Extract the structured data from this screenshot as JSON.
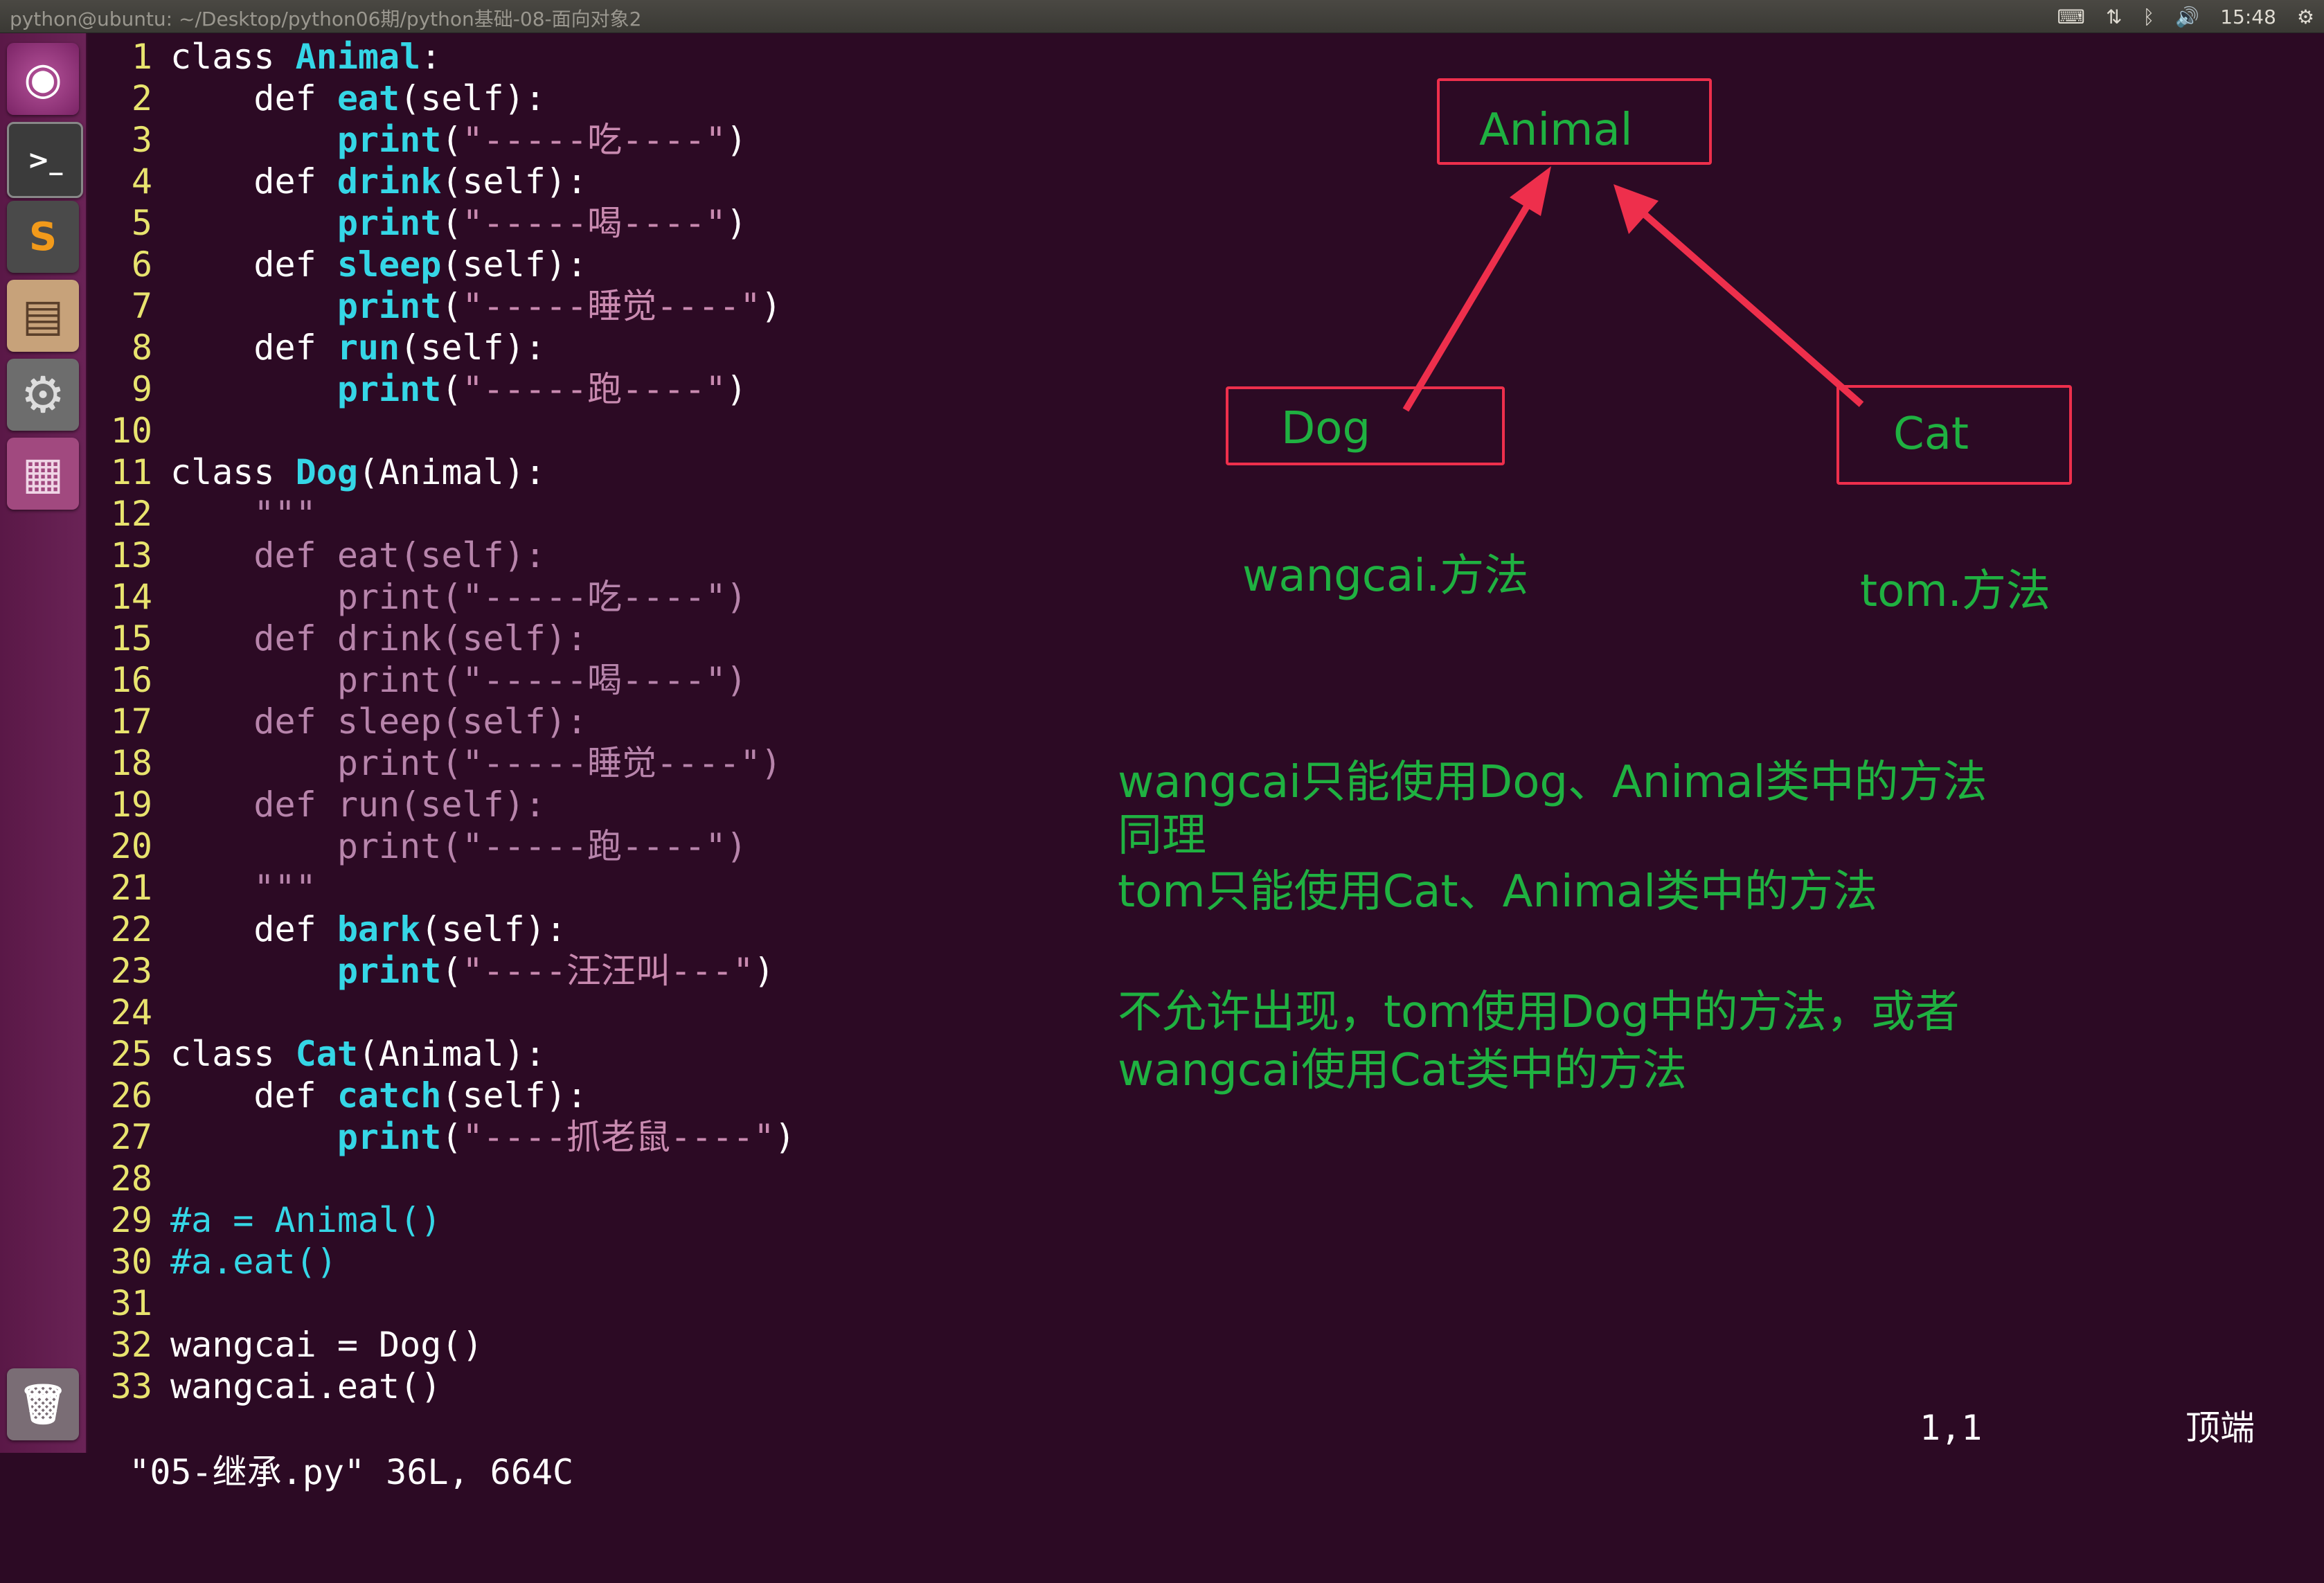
{
  "window": {
    "title": "python@ubuntu: ~/Desktop/python06期/python基础-08-面向对象2",
    "clock": "15:48"
  },
  "launcher": {
    "items": [
      {
        "name": "dash-icon",
        "glyph": "◉"
      },
      {
        "name": "terminal-icon",
        "glyph": ">_"
      },
      {
        "name": "sublime-text-icon",
        "glyph": "S"
      },
      {
        "name": "file-cabinet-icon",
        "glyph": "▤"
      },
      {
        "name": "settings-icon",
        "glyph": "⚙"
      },
      {
        "name": "workspace-switcher-icon",
        "glyph": "▦"
      },
      {
        "name": "trash-icon",
        "glyph": "🗑"
      }
    ]
  },
  "code": {
    "lines": [
      {
        "n": "1",
        "code": "class Animal:"
      },
      {
        "n": "2",
        "code": "    def eat(self):"
      },
      {
        "n": "3",
        "code": "        print(\"-----吃----\")"
      },
      {
        "n": "4",
        "code": "    def drink(self):"
      },
      {
        "n": "5",
        "code": "        print(\"-----喝----\")"
      },
      {
        "n": "6",
        "code": "    def sleep(self):"
      },
      {
        "n": "7",
        "code": "        print(\"-----睡觉----\")"
      },
      {
        "n": "8",
        "code": "    def run(self):"
      },
      {
        "n": "9",
        "code": "        print(\"-----跑----\")"
      },
      {
        "n": "10",
        "code": ""
      },
      {
        "n": "11",
        "code": "class Dog(Animal):"
      },
      {
        "n": "12",
        "code": "    \"\"\""
      },
      {
        "n": "13",
        "code": "    def eat(self):"
      },
      {
        "n": "14",
        "code": "        print(\"-----吃----\")"
      },
      {
        "n": "15",
        "code": "    def drink(self):"
      },
      {
        "n": "16",
        "code": "        print(\"-----喝----\")"
      },
      {
        "n": "17",
        "code": "    def sleep(self):"
      },
      {
        "n": "18",
        "code": "        print(\"-----睡觉----\")"
      },
      {
        "n": "19",
        "code": "    def run(self):"
      },
      {
        "n": "20",
        "code": "        print(\"-----跑----\")"
      },
      {
        "n": "21",
        "code": "    \"\"\""
      },
      {
        "n": "22",
        "code": "    def bark(self):"
      },
      {
        "n": "23",
        "code": "        print(\"----汪汪叫---\")"
      },
      {
        "n": "24",
        "code": ""
      },
      {
        "n": "25",
        "code": "class Cat(Animal):"
      },
      {
        "n": "26",
        "code": "    def catch(self):"
      },
      {
        "n": "27",
        "code": "        print(\"----抓老鼠----\")"
      },
      {
        "n": "28",
        "code": ""
      },
      {
        "n": "29",
        "code": "#a = Animal()"
      },
      {
        "n": "30",
        "code": "#a.eat()"
      },
      {
        "n": "31",
        "code": ""
      },
      {
        "n": "32",
        "code": "wangcai = Dog()"
      },
      {
        "n": "33",
        "code": "wangcai.eat()"
      }
    ]
  },
  "statusbar": {
    "file_info": "\"05-继承.py\" 36L, 664C",
    "cursor": "1,1",
    "scroll": "顶端"
  },
  "diagram": {
    "animal": "Animal",
    "dog": "Dog",
    "cat": "Cat",
    "wangcai_methods": "wangcai.方法",
    "tom_methods": "tom.方法"
  },
  "notes": {
    "line1": "wangcai只能使用Dog、Animal类中的方法",
    "line2": "同理",
    "line3": "tom只能使用Cat、Animal类中的方法",
    "line4": "不允许出现，tom使用Dog中的方法，或者",
    "line5": "wangcai使用Cat类中的方法"
  },
  "colors": {
    "background": "#2c0a24",
    "line_number": "#e8e36e",
    "keyword_function": "#35d6e6",
    "string": "#c98ab0",
    "annotation_green": "#1fb141",
    "annotation_red": "#ee2f4c"
  }
}
